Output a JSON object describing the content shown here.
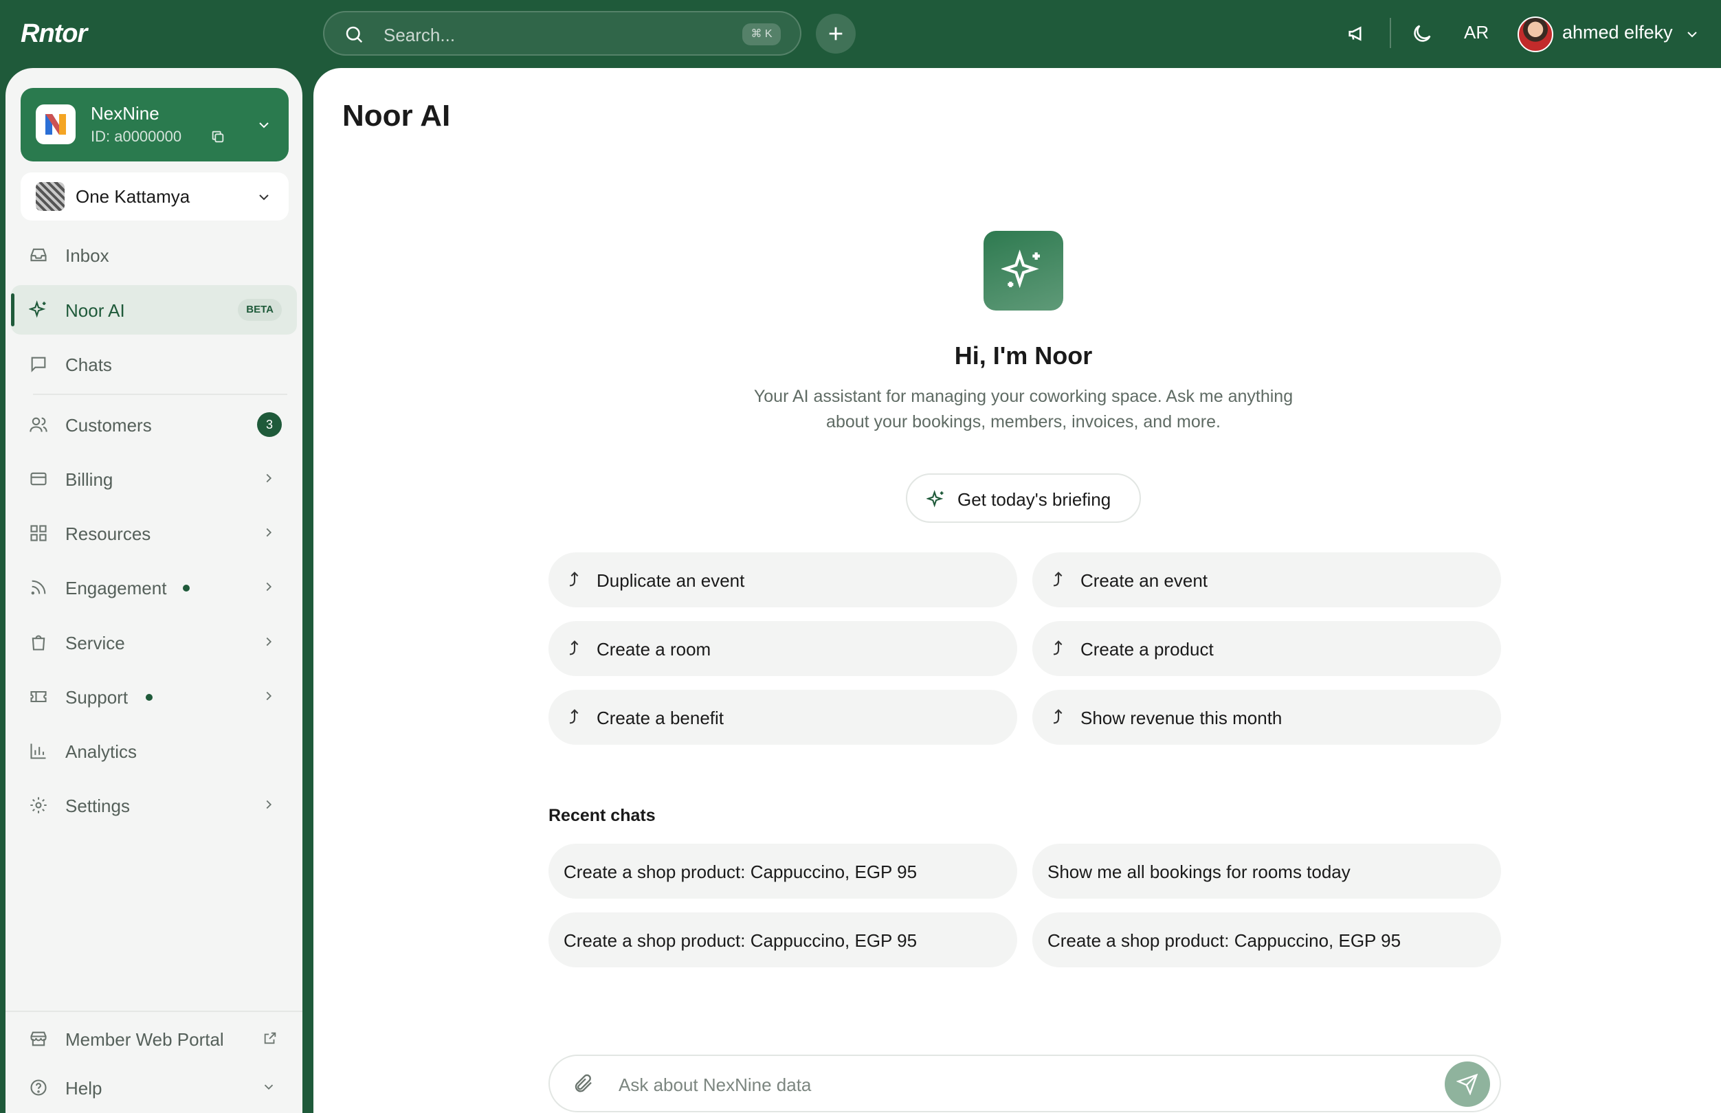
{
  "app": {
    "logo": "Rntor"
  },
  "topbar": {
    "search_placeholder": "Search...",
    "search_shortcut": "⌘ K",
    "language": "AR",
    "user_name": "ahmed elfeky"
  },
  "sidebar": {
    "workspace": {
      "name": "NexNine",
      "id": "ID: a0000000"
    },
    "location": {
      "name": "One Kattamya"
    },
    "items": [
      {
        "label": "Inbox"
      },
      {
        "label": "Noor AI",
        "badge": "BETA"
      },
      {
        "label": "Chats"
      },
      {
        "label": "Customers",
        "count": "3"
      },
      {
        "label": "Billing"
      },
      {
        "label": "Resources"
      },
      {
        "label": "Engagement"
      },
      {
        "label": "Service"
      },
      {
        "label": "Support"
      },
      {
        "label": "Analytics"
      },
      {
        "label": "Settings"
      }
    ],
    "footer": [
      {
        "label": "Member Web Portal"
      },
      {
        "label": "Help"
      }
    ]
  },
  "main": {
    "title": "Noor AI",
    "greeting": "Hi, I'm Noor",
    "subtitle": "Your AI assistant for managing your coworking space. Ask me anything about your bookings, members, invoices, and more.",
    "briefing_label": "Get today's briefing",
    "suggestions": [
      "Duplicate an event",
      "Create an event",
      "Create a room",
      "Create a product",
      "Create a benefit",
      "Show revenue this month"
    ],
    "recent_heading": "Recent chats",
    "recent_chats": [
      "Create a shop product: Cappuccino, EGP 95",
      "Show me all bookings for rooms today",
      "Create a shop product: Cappuccino, EGP 95",
      "Create a shop product: Cappuccino, EGP 95"
    ],
    "composer_placeholder": "Ask about NexNine data"
  },
  "colors": {
    "brand": "#1f5a3a",
    "workspace_card": "#2a7a4e",
    "send_button": "#8fb39d"
  },
  "icons": {
    "search": "search-icon",
    "add": "plus-icon",
    "announce": "megaphone-icon",
    "theme": "moon-icon",
    "ai": "sparkle-icon",
    "attach": "paperclip-icon",
    "send": "send-icon"
  }
}
